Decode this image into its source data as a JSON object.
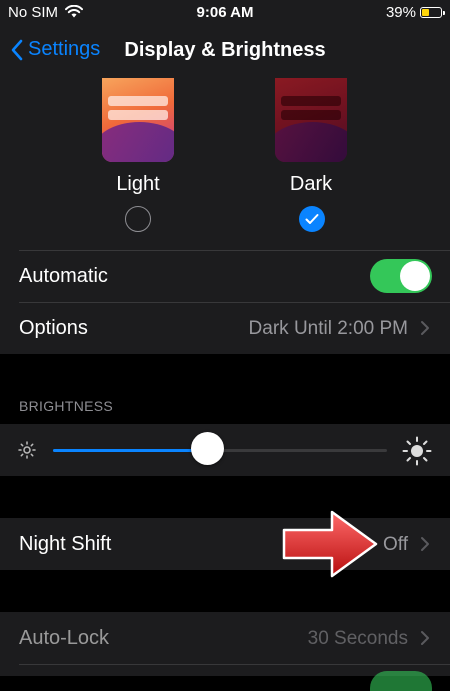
{
  "status_bar": {
    "carrier": "No SIM",
    "time": "9:06 AM",
    "battery": "39%"
  },
  "nav": {
    "back_label": "Settings",
    "title": "Display & Brightness"
  },
  "appearance": {
    "light_label": "Light",
    "dark_label": "Dark",
    "selected": "Dark"
  },
  "automatic": {
    "label": "Automatic",
    "on": true
  },
  "options": {
    "label": "Options",
    "value": "Dark Until 2:00 PM"
  },
  "brightness": {
    "header": "BRIGHTNESS",
    "level": 0.46
  },
  "night_shift": {
    "label": "Night Shift",
    "value": "Off"
  },
  "auto_lock": {
    "label": "Auto-Lock",
    "value": "30 Seconds"
  },
  "colors": {
    "accent": "#0a84ff",
    "toggle_on": "#34c759",
    "battery": "#ffd60a",
    "annotation_arrow": "#e02020"
  }
}
